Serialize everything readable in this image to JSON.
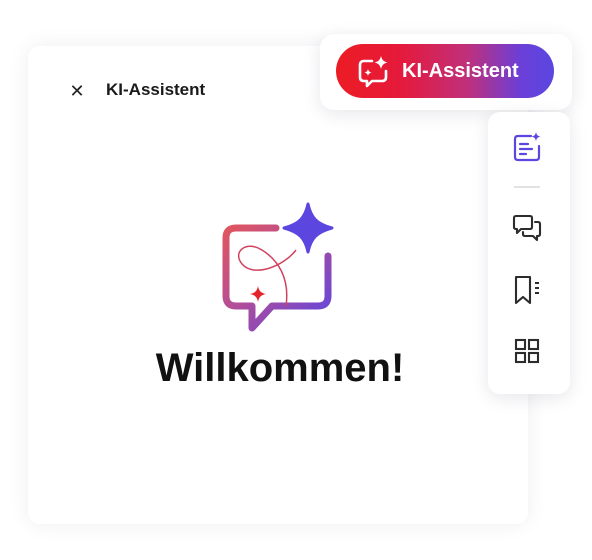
{
  "panel": {
    "close_glyph": "✕",
    "title": "KI-Assistent"
  },
  "welcome": {
    "icon": "ai-assistant-chat-sparkle-icon",
    "heading": "Willkommen!"
  },
  "toolbar": {
    "ai_button_label": "KI-Assistent",
    "ai_button_icon": "ai-assistant-icon",
    "ai_button_gradient": [
      "#ec1c24",
      "#5b46e0"
    ]
  },
  "side_rail": {
    "items": [
      {
        "icon": "ai-summary-icon",
        "active": true
      },
      {
        "icon": "comments-icon",
        "active": false
      },
      {
        "icon": "bookmarks-icon",
        "active": false
      },
      {
        "icon": "thumbnails-grid-icon",
        "active": false
      }
    ]
  },
  "colors": {
    "accent": "#5b46e0",
    "brand_red": "#ec1c24",
    "text": "#111111"
  }
}
